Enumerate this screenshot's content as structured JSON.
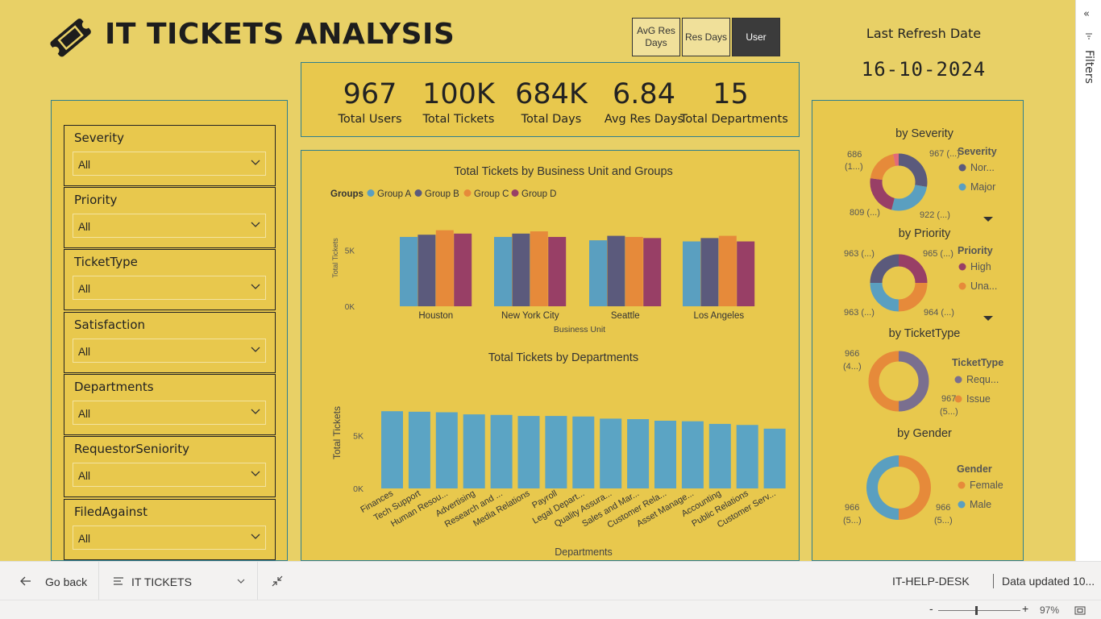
{
  "header": {
    "title": "IT TICKETS ANALYSIS",
    "nav_buttons": [
      {
        "label": "AvG Res Days"
      },
      {
        "label": "Res Days"
      },
      {
        "label": "User"
      }
    ],
    "refresh_label": "Last Refresh Date",
    "refresh_date": "16-10-2024"
  },
  "kpis": [
    {
      "value": "967",
      "label": "Total Users"
    },
    {
      "value": "100K",
      "label": "Total Tickets"
    },
    {
      "value": "684K",
      "label": "Total Days"
    },
    {
      "value": "6.84",
      "label": "Avg Res Days"
    },
    {
      "value": "15",
      "label": "Total Departments"
    }
  ],
  "slicers": [
    {
      "title": "Severity",
      "value": "All"
    },
    {
      "title": "Priority",
      "value": "All"
    },
    {
      "title": "TicketType",
      "value": "All"
    },
    {
      "title": "Satisfaction",
      "value": "All"
    },
    {
      "title": "Departments",
      "value": "All"
    },
    {
      "title": "RequestorSeniority",
      "value": "All"
    },
    {
      "title": "FiledAgainst",
      "value": "All"
    }
  ],
  "colors": {
    "background": "#e8d066",
    "panel": "#e8c84d",
    "panel_border": "#2e7f8e",
    "group_a": "#5a9fc0",
    "group_b": "#5b5a7c",
    "group_c": "#e68a3a",
    "group_d": "#983f66",
    "bar_single": "#5ba4c4"
  },
  "chart_data": [
    {
      "type": "bar",
      "title": "Total Tickets by Business Unit and Groups",
      "legend_title": "Groups",
      "xlabel": "Business Unit",
      "ylabel": "Total Tickets",
      "categories": [
        "Houston",
        "New York City",
        "Seattle",
        "Los Angeles"
      ],
      "series": [
        {
          "name": "Group A",
          "values": [
            6200,
            6200,
            5900,
            5800
          ]
        },
        {
          "name": "Group B",
          "values": [
            6400,
            6500,
            6300,
            6100
          ]
        },
        {
          "name": "Group C",
          "values": [
            6800,
            6700,
            6200,
            6300
          ]
        },
        {
          "name": "Group D",
          "values": [
            6500,
            6200,
            6100,
            5800
          ]
        }
      ],
      "yticks": [
        "0K",
        "5K"
      ],
      "ylim": [
        0,
        8000
      ],
      "legend_position": "top-left"
    },
    {
      "type": "bar",
      "title": "Total Tickets by Departments",
      "xlabel": "Departments",
      "ylabel": "Total Tickets",
      "categories": [
        "Finances",
        "Tech Support",
        "Human Resou...",
        "Advertising",
        "Research and ...",
        "Media Relations",
        "Payroll",
        "Legal Depart...",
        "Quality Assura...",
        "Sales and Mar...",
        "Customer Rela...",
        "Asset Manage...",
        "Accounting",
        "Public Relations",
        "Customer Serv..."
      ],
      "values": [
        7300,
        7250,
        7200,
        7000,
        6950,
        6850,
        6850,
        6800,
        6600,
        6550,
        6400,
        6350,
        6100,
        6000,
        5650
      ],
      "yticks": [
        "0K",
        "5K"
      ],
      "ylim": [
        0,
        8000
      ]
    },
    {
      "type": "pie",
      "title": "by Severity",
      "legend_title": "Severity",
      "legend": [
        "Nor...",
        "Major"
      ],
      "slice_labels": [
        "967 (...)",
        "922 (...)",
        "809 (...)",
        "686 (1...)"
      ],
      "values": [
        967,
        922,
        809,
        686,
        110
      ]
    },
    {
      "type": "pie",
      "title": "by Priority",
      "legend_title": "Priority",
      "legend": [
        "High",
        "Una..."
      ],
      "slice_labels": [
        "965 (...)",
        "964 (...)",
        "963 (...)",
        "963 (...)"
      ],
      "values": [
        965,
        964,
        963,
        963
      ]
    },
    {
      "type": "pie",
      "title": "by TicketType",
      "legend_title": "TicketType",
      "legend": [
        "Requ...",
        "Issue"
      ],
      "slice_labels": [
        "966 (4...)",
        "967 (5...)"
      ],
      "values": [
        966,
        967
      ]
    },
    {
      "type": "pie",
      "title": "by Gender",
      "legend_title": "Gender",
      "legend": [
        "Female",
        "Male"
      ],
      "slice_labels": [
        "966 (5...)",
        "966 (5...)"
      ],
      "values": [
        966,
        966
      ]
    }
  ],
  "footer": {
    "back_label": "Go back",
    "page_label": "IT TICKETS",
    "workspace": "IT-HELP-DESK",
    "data_updated": "Data updated 10...",
    "zoom": "97%",
    "filters_label": "Filters"
  }
}
